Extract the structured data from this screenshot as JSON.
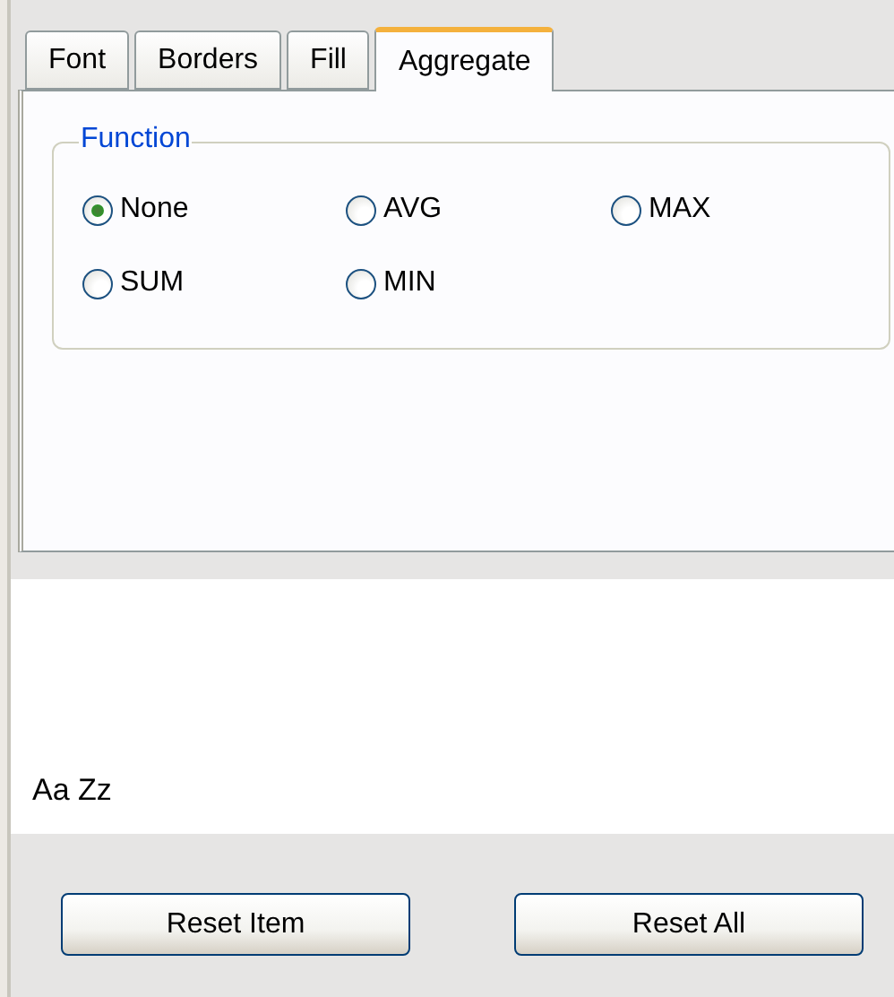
{
  "tabs": [
    {
      "label": "Font",
      "selected": false
    },
    {
      "label": "Borders",
      "selected": false
    },
    {
      "label": "Fill",
      "selected": false
    },
    {
      "label": "Aggregate",
      "selected": true
    }
  ],
  "function_group": {
    "title": "Function",
    "options": [
      {
        "label": "None",
        "selected": true
      },
      {
        "label": "AVG",
        "selected": false
      },
      {
        "label": "MAX",
        "selected": false
      },
      {
        "label": "SUM",
        "selected": false
      },
      {
        "label": "MIN",
        "selected": false
      }
    ]
  },
  "preview": {
    "sample": "Aa Zz"
  },
  "buttons": [
    "Reset Item",
    "Reset All"
  ]
}
